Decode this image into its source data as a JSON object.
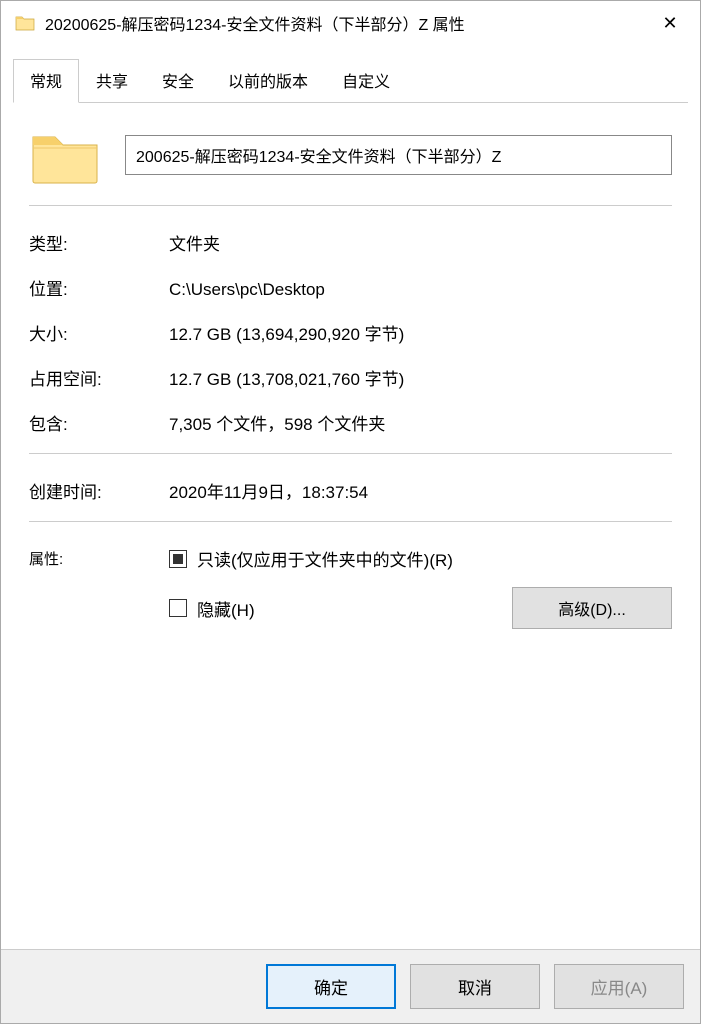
{
  "titlebar": {
    "title": "20200625-解压密码1234-安全文件资料（下半部分）Z 属性"
  },
  "tabs": {
    "general": "常规",
    "sharing": "共享",
    "security": "安全",
    "previous": "以前的版本",
    "customize": "自定义"
  },
  "name_field": {
    "value": "200625-解压密码1234-安全文件资料（下半部分）Z"
  },
  "props": {
    "type_label": "类型:",
    "type_value": "文件夹",
    "location_label": "位置:",
    "location_value": "C:\\Users\\pc\\Desktop",
    "size_label": "大小:",
    "size_value": "12.7 GB (13,694,290,920 字节)",
    "sizeondisk_label": "占用空间:",
    "sizeondisk_value": "12.7 GB (13,708,021,760 字节)",
    "contains_label": "包含:",
    "contains_value": "7,305 个文件，598 个文件夹",
    "created_label": "创建时间:",
    "created_value": "2020年11月9日，18:37:54",
    "attr_label": "属性:"
  },
  "attrs": {
    "readonly_label": "只读(仅应用于文件夹中的文件)(R)",
    "hidden_label": "隐藏(H)",
    "advanced_label": "高级(D)..."
  },
  "footer": {
    "ok": "确定",
    "cancel": "取消",
    "apply": "应用(A)"
  }
}
